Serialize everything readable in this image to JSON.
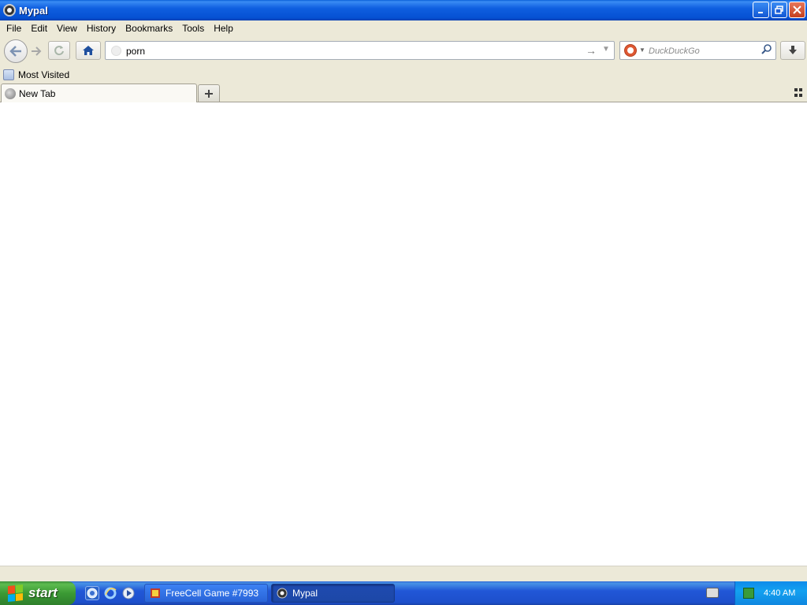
{
  "window": {
    "title": "Mypal"
  },
  "menu": [
    "File",
    "Edit",
    "View",
    "History",
    "Bookmarks",
    "Tools",
    "Help"
  ],
  "nav": {
    "back_icon": "back-arrow-icon",
    "forward_icon": "forward-arrow-icon",
    "reload_icon": "reload-icon",
    "home_icon": "home-icon",
    "url_value": "porn",
    "search_placeholder": "DuckDuckGo",
    "download_icon": "download-arrow-icon"
  },
  "bookmarks": {
    "most_visited": "Most Visited"
  },
  "tabs": [
    {
      "label": "New Tab",
      "active": true
    }
  ],
  "taskbar": {
    "start_label": "start",
    "tasks": [
      {
        "label": "FreeCell Game #7993",
        "active": false
      },
      {
        "label": "Mypal",
        "active": true
      }
    ],
    "clock": "4:40 AM"
  },
  "colors": {
    "titlebar": "#0550d2",
    "taskbar": "#2157d7",
    "start": "#3b9a34",
    "chrome": "#ece9d8"
  }
}
